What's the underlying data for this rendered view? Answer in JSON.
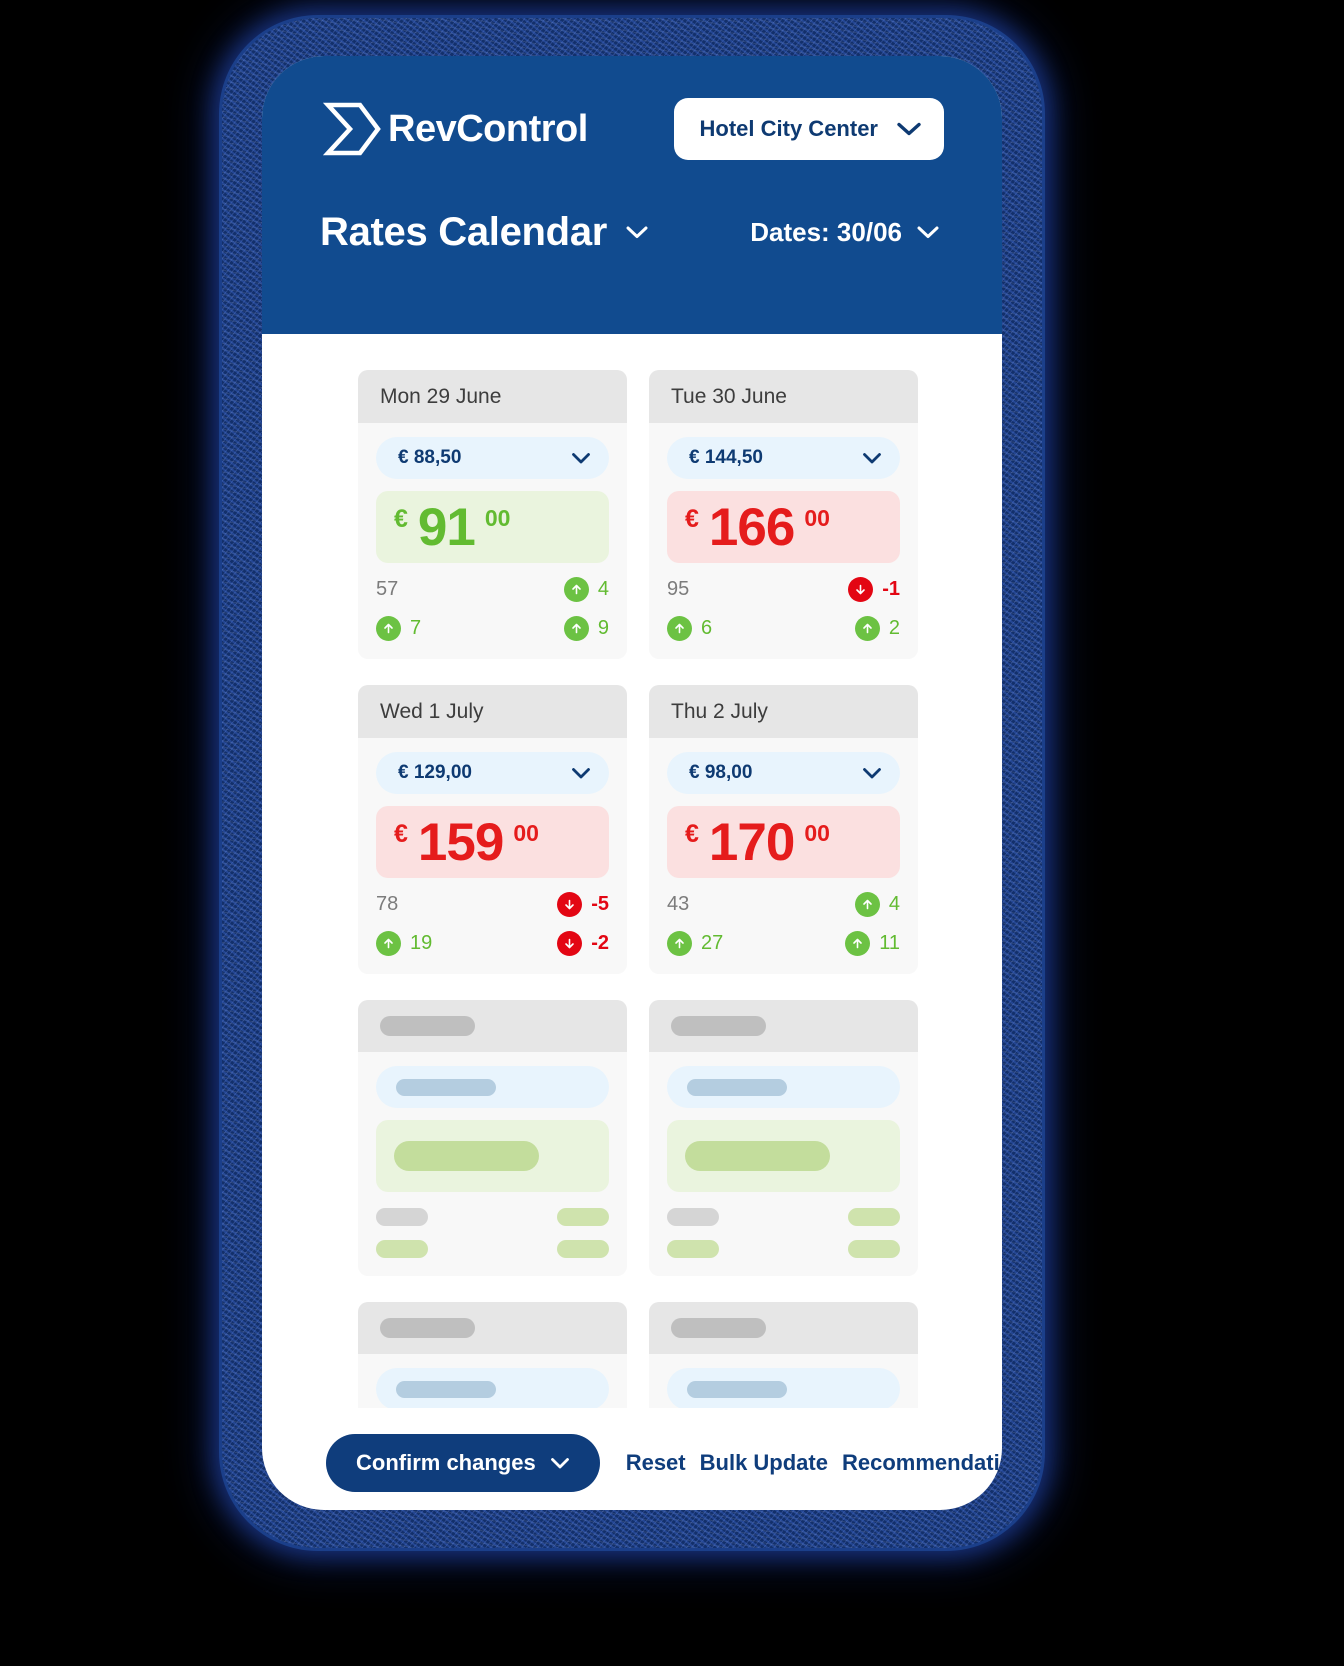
{
  "brand": {
    "name": "RevControl",
    "logo_icon": "revcontrol-logo-icon"
  },
  "header": {
    "hotel_selector": {
      "value": "Hotel City Center",
      "icon": "chevron-down-icon"
    },
    "page_title": "Rates Calendar",
    "page_title_icon": "chevron-down-icon",
    "dates_label": "Dates: 30/06",
    "dates_icon": "chevron-down-icon"
  },
  "colors": {
    "brand_blue": "#114b8f",
    "deep_blue": "#0f3d7c",
    "up_green": "#62bb31",
    "badge_green": "#6cc243",
    "down_red": "#e30613",
    "rate_red": "#e51c1c",
    "rate_up_bg": "#eaf4de",
    "rate_down_bg": "#fbe0e0",
    "pill_bg": "#e8f4fd",
    "card_bg": "#f8f8f8",
    "card_head_bg": "#e6e6e6"
  },
  "cards": [
    {
      "date": "Mon 29 June",
      "compset_value": "€ 88,50",
      "compset_icon": "chevron-down-icon",
      "currency": "€",
      "rate_main": "91",
      "rate_decimals": "00",
      "direction": "up",
      "stats": [
        {
          "left": {
            "value": "57",
            "type": "plain"
          },
          "right": {
            "value": "4",
            "type": "up",
            "icon": "arrow-up-icon"
          }
        },
        {
          "left": {
            "value": "7",
            "type": "up",
            "icon": "arrow-up-icon"
          },
          "right": {
            "value": "9",
            "type": "up",
            "icon": "arrow-up-icon"
          }
        }
      ]
    },
    {
      "date": "Tue 30 June",
      "compset_value": "€ 144,50",
      "compset_icon": "chevron-down-icon",
      "currency": "€",
      "rate_main": "166",
      "rate_decimals": "00",
      "direction": "down",
      "stats": [
        {
          "left": {
            "value": "95",
            "type": "plain"
          },
          "right": {
            "value": "-1",
            "type": "down",
            "icon": "arrow-down-icon"
          }
        },
        {
          "left": {
            "value": "6",
            "type": "up",
            "icon": "arrow-up-icon"
          },
          "right": {
            "value": "2",
            "type": "up",
            "icon": "arrow-up-icon"
          }
        }
      ]
    },
    {
      "date": "Wed 1 July",
      "compset_value": "€ 129,00",
      "compset_icon": "chevron-down-icon",
      "currency": "€",
      "rate_main": "159",
      "rate_decimals": "00",
      "direction": "down",
      "stats": [
        {
          "left": {
            "value": "78",
            "type": "plain"
          },
          "right": {
            "value": "-5",
            "type": "down",
            "icon": "arrow-down-icon"
          }
        },
        {
          "left": {
            "value": "19",
            "type": "up",
            "icon": "arrow-up-icon"
          },
          "right": {
            "value": "-2",
            "type": "down",
            "icon": "arrow-down-icon"
          }
        }
      ]
    },
    {
      "date": "Thu 2 July",
      "compset_value": "€ 98,00",
      "compset_icon": "chevron-down-icon",
      "currency": "€",
      "rate_main": "170",
      "rate_decimals": "00",
      "direction": "down",
      "stats": [
        {
          "left": {
            "value": "43",
            "type": "plain"
          },
          "right": {
            "value": "4",
            "type": "up",
            "icon": "arrow-up-icon"
          }
        },
        {
          "left": {
            "value": "27",
            "type": "up",
            "icon": "arrow-up-icon"
          },
          "right": {
            "value": "11",
            "type": "up",
            "icon": "arrow-up-icon"
          }
        }
      ]
    }
  ],
  "skeleton_cards": [
    {
      "rate_tone": "up"
    },
    {
      "rate_tone": "up"
    },
    {
      "rate_tone": "up"
    },
    {
      "rate_tone": "down"
    }
  ],
  "footer": {
    "confirm_label": "Confirm changes",
    "confirm_icon": "chevron-down-icon",
    "reset_label": "Reset",
    "bulk_update_label": "Bulk Update",
    "recommendations_label": "Recommendations",
    "recommendations_icon": "chevron-down-icon"
  }
}
